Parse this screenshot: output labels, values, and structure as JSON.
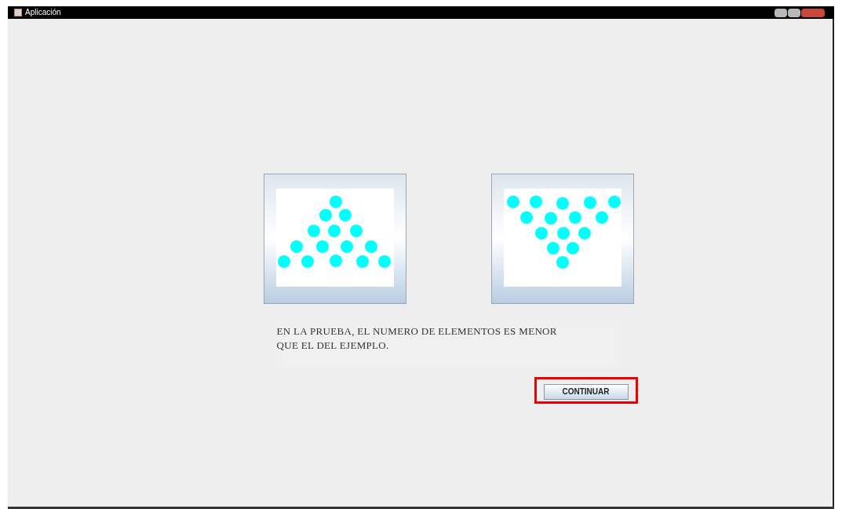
{
  "window": {
    "title": "Aplicación"
  },
  "message": {
    "lines": [
      "EN LA PRUEBA, EL NUMERO DE ELEMENTOS ES MENOR",
      "QUE EL DEL EJEMPLO."
    ]
  },
  "button": {
    "label": "CONTINUAR",
    "highlighted": true
  }
}
